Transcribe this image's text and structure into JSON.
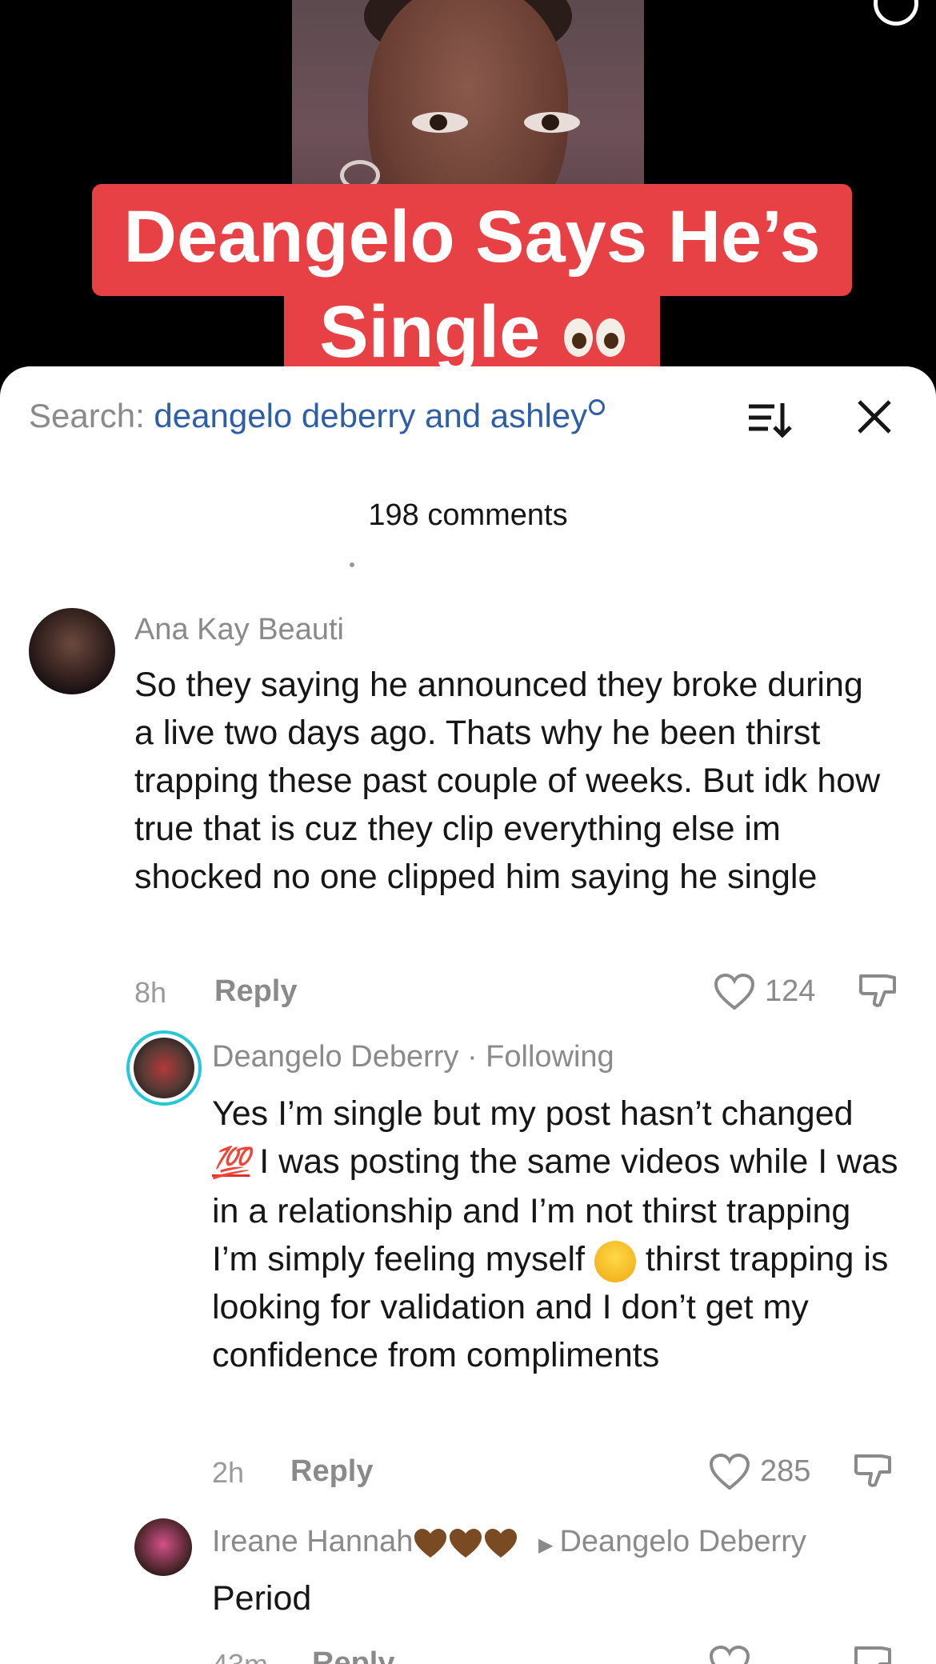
{
  "video": {
    "caption_line1": "Deangelo Says He’s",
    "caption_line2": "Single"
  },
  "comments_sheet": {
    "search_label": "Search:",
    "search_query": "deangelo deberry and ashley",
    "comment_count": "198 comments",
    "comments": [
      {
        "username": "Ana Kay Beauti",
        "text": "So they saying he announced they broke during a live two days ago. Thats why he been thirst trapping these past couple of weeks. But idk how true that is cuz they clip everything else im shocked no one clipped him saying he single",
        "time": "8h",
        "reply_label": "Reply",
        "likes": "124"
      },
      {
        "username": "Deangelo Deberry · Following",
        "text_part1": "Yes I’m single but my post hasn’t changed",
        "emoji_100": "💯",
        "text_part2": "I was posting the same videos while I was in a relationship and I’m not thirst trapping I’m simply feeling myself",
        "text_part3": "thirst trapping is looking for validation and I don’t get my confidence from compliments",
        "time": "2h",
        "reply_label": "Reply",
        "likes": "285"
      },
      {
        "username": "Ireane Hannah",
        "reply_to": "Deangelo Deberry",
        "text": "Period",
        "time": "43m",
        "reply_label": "Reply"
      }
    ]
  }
}
